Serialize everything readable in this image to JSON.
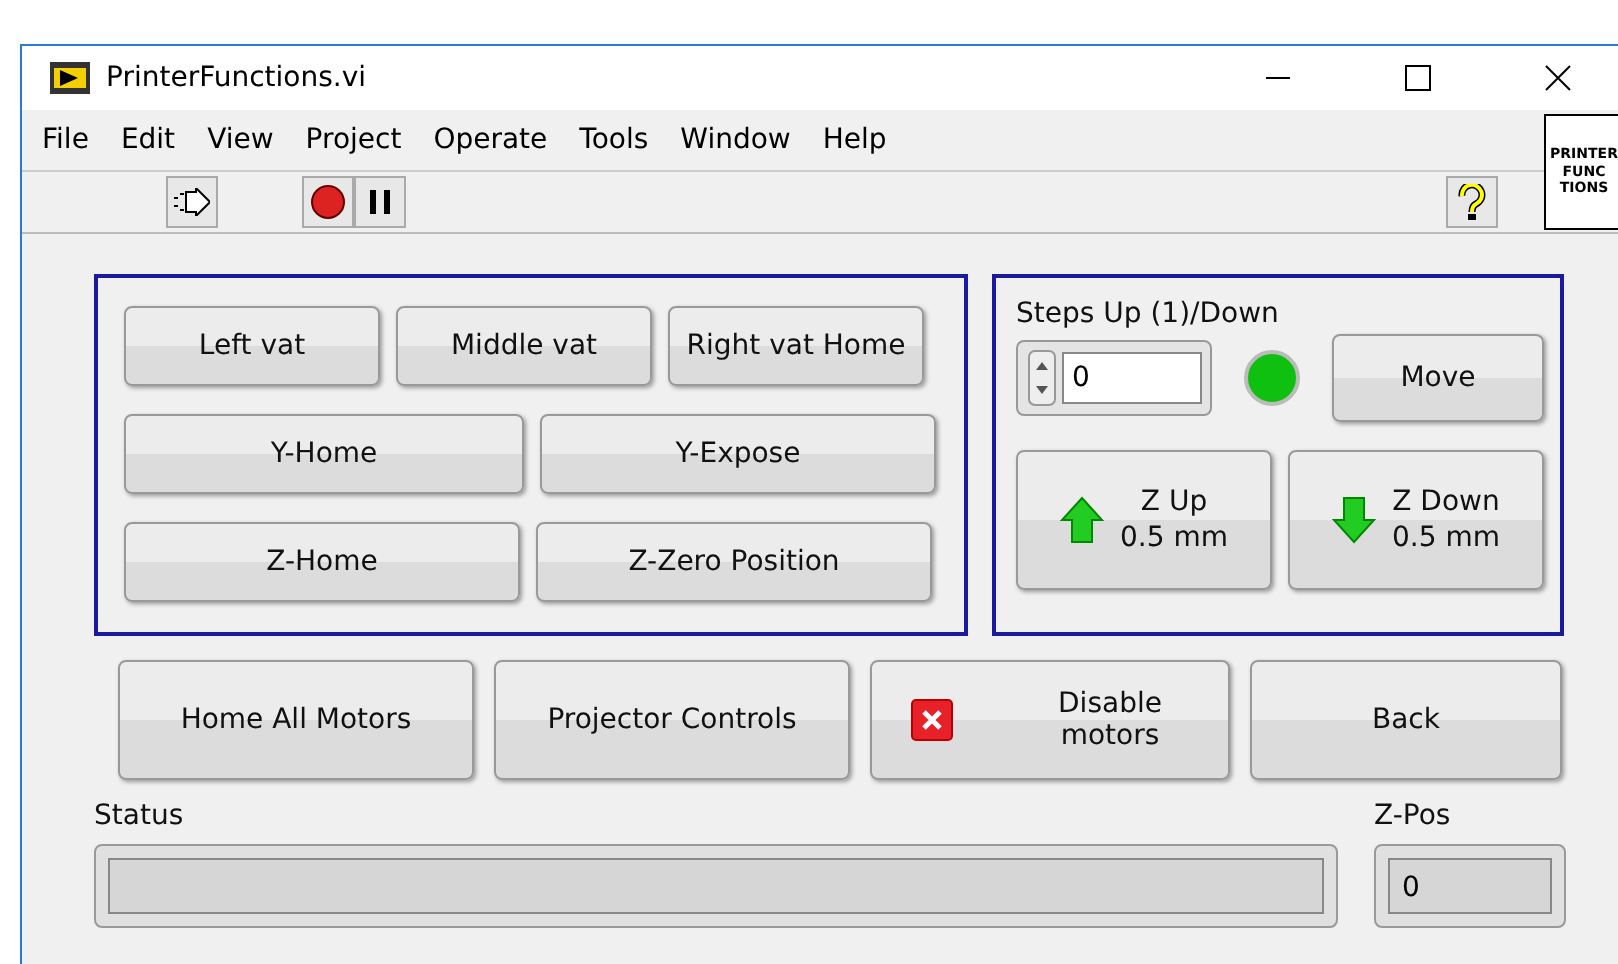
{
  "window": {
    "title": "PrinterFunctions.vi"
  },
  "menu": [
    "File",
    "Edit",
    "View",
    "Project",
    "Operate",
    "Tools",
    "Window",
    "Help"
  ],
  "vi_icon": [
    "PRINTER",
    "FUNC",
    "TIONS"
  ],
  "toolbar": [
    {
      "kind": "run"
    },
    {
      "kind": "abort"
    },
    {
      "kind": "pause"
    },
    {
      "kind": "help"
    }
  ],
  "position_buttons": [
    {
      "label": "Left vat"
    },
    {
      "label": "Middle vat"
    },
    {
      "label": "Right vat Home"
    },
    {
      "label": "Y-Home"
    },
    {
      "label": "Y-Expose"
    },
    {
      "label": "Z-Home"
    },
    {
      "label": "Z-Zero Position"
    }
  ],
  "steps": {
    "label": "Steps Up (1)/Down",
    "value": "0",
    "led_on": true,
    "move": "Move"
  },
  "z_buttons": [
    {
      "kind": "up",
      "lines": [
        "Z Up",
        "0.5 mm"
      ]
    },
    {
      "kind": "down",
      "lines": [
        "Z Down",
        "0.5 mm"
      ]
    }
  ],
  "bottom_buttons": [
    {
      "label": "Home All Motors"
    },
    {
      "label": "Projector Controls"
    },
    {
      "label": "Disable motors",
      "kind": "disable"
    },
    {
      "label": "Back"
    }
  ],
  "status": {
    "label": "Status"
  },
  "z_pos": {
    "label": "Z-Pos",
    "value": "0"
  }
}
